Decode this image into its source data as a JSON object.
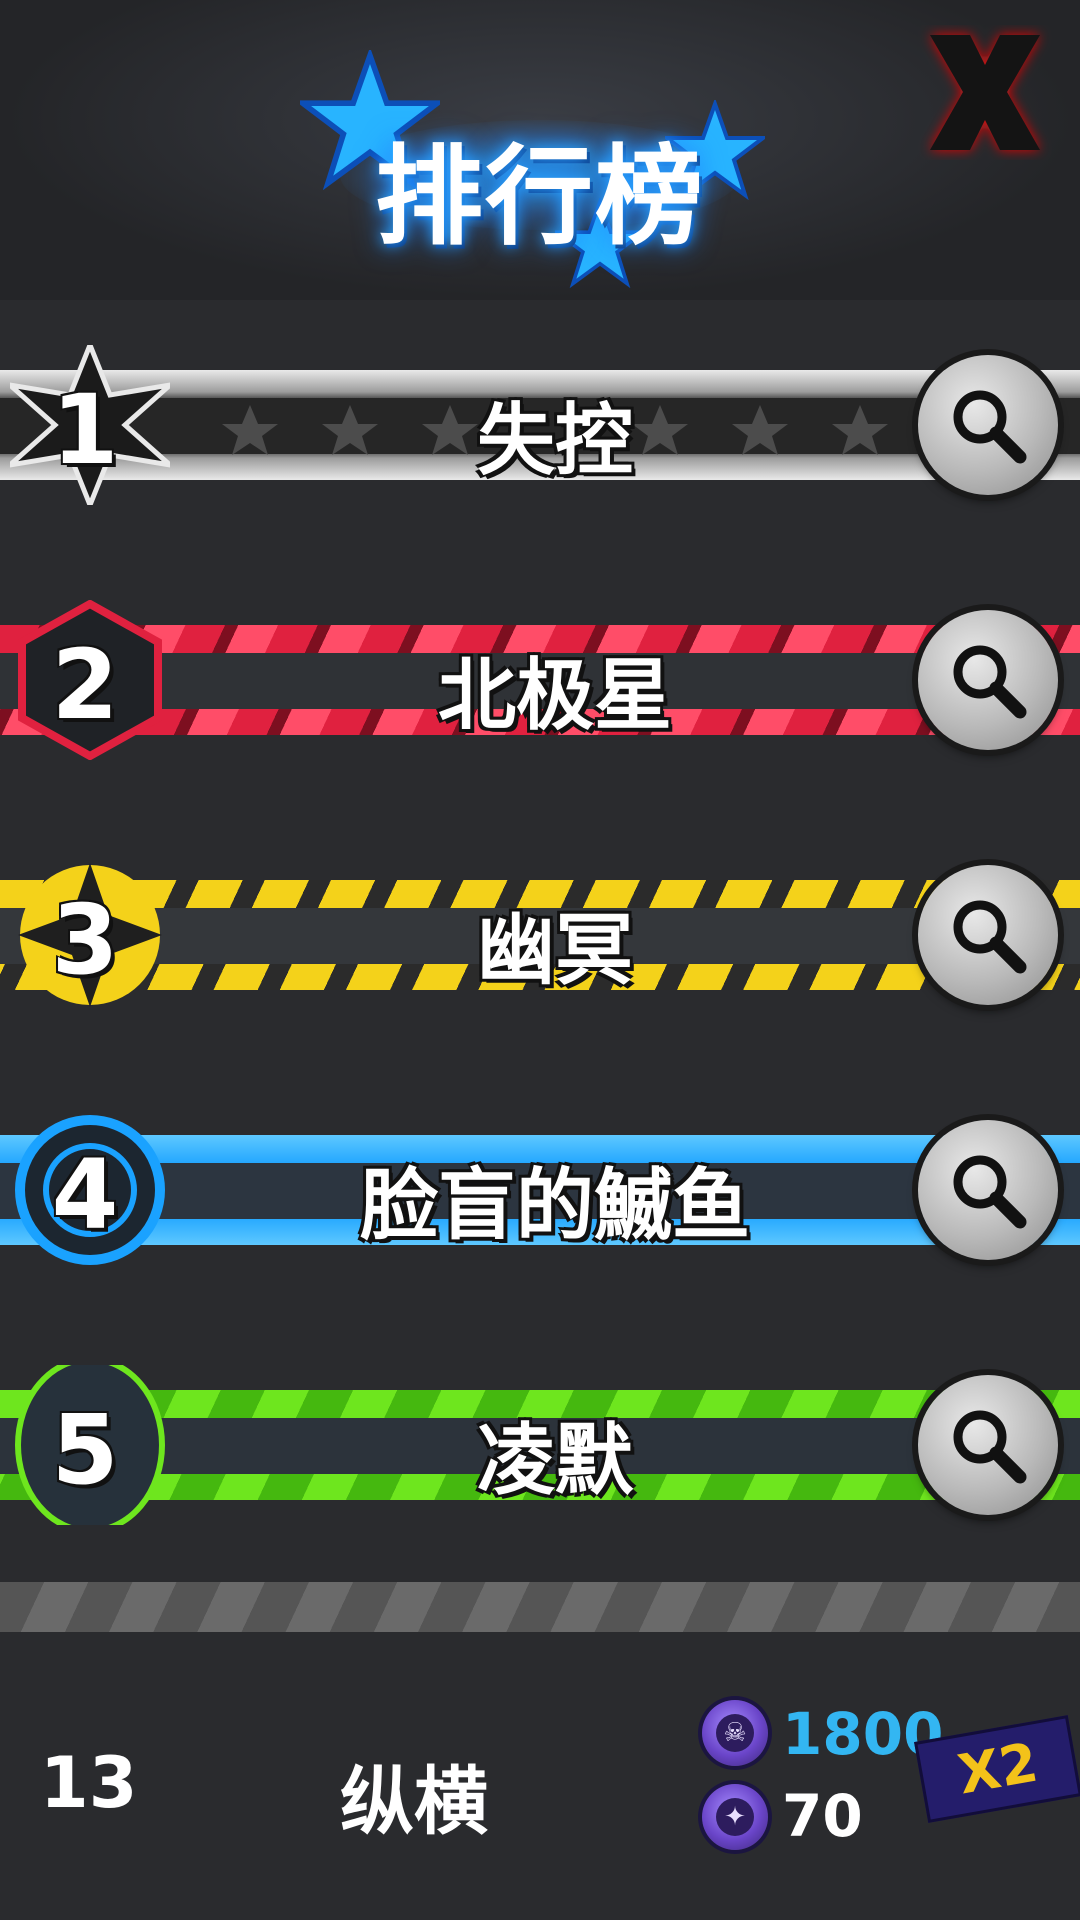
{
  "header": {
    "title": "排行榜"
  },
  "leaderboard": [
    {
      "rank": "1",
      "name": "失控",
      "theme": "#d8d8d8"
    },
    {
      "rank": "2",
      "name": "北极星",
      "theme": "#e0213f"
    },
    {
      "rank": "3",
      "name": "幽冥",
      "theme": "#f4d21a"
    },
    {
      "rank": "4",
      "name": "脸盲的鰄鱼",
      "theme": "#1aa2ff"
    },
    {
      "rank": "5",
      "name": "凌默",
      "theme": "#6ee61e"
    }
  ],
  "my_entry": {
    "rank": "13",
    "name": "纵横",
    "currency_primary": "1800",
    "currency_secondary": "70",
    "multiplier": "X2"
  },
  "icons": {
    "close": "close-x-icon",
    "view": "magnifier-icon",
    "star": "star-icon",
    "coin": "coin-icon"
  },
  "colors": {
    "title_glow": "#2aa4ff",
    "close_red": "#e01010",
    "currency_blue": "#33b6f2",
    "multiplier_gold": "#f3c21a"
  }
}
